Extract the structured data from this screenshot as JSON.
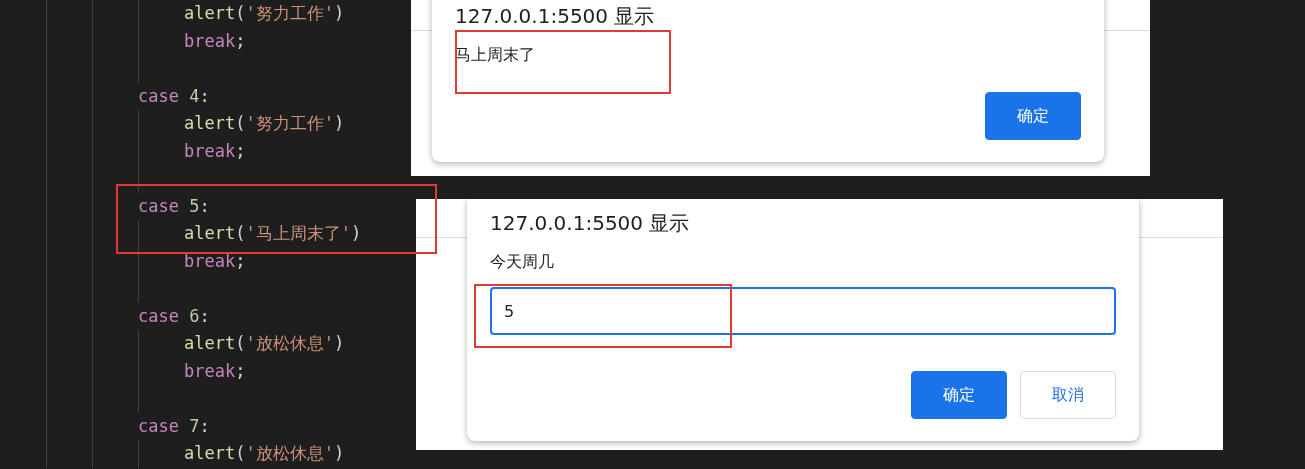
{
  "editor": {
    "lines": [
      {
        "kind": "body",
        "tokens": [
          {
            "kind": "function",
            "text": "alert"
          },
          {
            "kind": "punct",
            "text": "("
          },
          {
            "kind": "string",
            "text": "'努力工作'"
          },
          {
            "kind": "punct",
            "text": ")"
          }
        ]
      },
      {
        "kind": "body",
        "tokens": [
          {
            "kind": "keyword",
            "text": "break"
          },
          {
            "kind": "punct",
            "text": ";"
          }
        ]
      },
      {
        "kind": "blank"
      },
      {
        "kind": "case",
        "tokens": [
          {
            "kind": "keyword",
            "text": "case"
          },
          {
            "kind": "number",
            "text": "4"
          },
          {
            "kind": "punct",
            "text": ":"
          }
        ]
      },
      {
        "kind": "body",
        "tokens": [
          {
            "kind": "function",
            "text": "alert"
          },
          {
            "kind": "punct",
            "text": "("
          },
          {
            "kind": "string",
            "text": "'努力工作'"
          },
          {
            "kind": "punct",
            "text": ")"
          }
        ]
      },
      {
        "kind": "body",
        "tokens": [
          {
            "kind": "keyword",
            "text": "break"
          },
          {
            "kind": "punct",
            "text": ";"
          }
        ]
      },
      {
        "kind": "blank"
      },
      {
        "kind": "case",
        "tokens": [
          {
            "kind": "keyword",
            "text": "case"
          },
          {
            "kind": "number",
            "text": "5"
          },
          {
            "kind": "punct",
            "text": ":"
          }
        ]
      },
      {
        "kind": "body",
        "tokens": [
          {
            "kind": "function",
            "text": "alert"
          },
          {
            "kind": "punct",
            "text": "("
          },
          {
            "kind": "string",
            "text": "'马上周末了'"
          },
          {
            "kind": "punct",
            "text": ")"
          }
        ]
      },
      {
        "kind": "body",
        "tokens": [
          {
            "kind": "keyword",
            "text": "break"
          },
          {
            "kind": "punct",
            "text": ";"
          }
        ]
      },
      {
        "kind": "blank"
      },
      {
        "kind": "case",
        "tokens": [
          {
            "kind": "keyword",
            "text": "case"
          },
          {
            "kind": "number",
            "text": "6"
          },
          {
            "kind": "punct",
            "text": ":"
          }
        ]
      },
      {
        "kind": "body",
        "tokens": [
          {
            "kind": "function",
            "text": "alert"
          },
          {
            "kind": "punct",
            "text": "("
          },
          {
            "kind": "string",
            "text": "'放松休息'"
          },
          {
            "kind": "punct",
            "text": ")"
          }
        ]
      },
      {
        "kind": "body",
        "tokens": [
          {
            "kind": "keyword",
            "text": "break"
          },
          {
            "kind": "punct",
            "text": ";"
          }
        ]
      },
      {
        "kind": "blank"
      },
      {
        "kind": "case",
        "tokens": [
          {
            "kind": "keyword",
            "text": "case"
          },
          {
            "kind": "number",
            "text": "7"
          },
          {
            "kind": "punct",
            "text": ":"
          }
        ]
      },
      {
        "kind": "body",
        "tokens": [
          {
            "kind": "function",
            "text": "alert"
          },
          {
            "kind": "punct",
            "text": "("
          },
          {
            "kind": "string",
            "text": "'放松休息'"
          },
          {
            "kind": "punct",
            "text": ")"
          }
        ]
      }
    ]
  },
  "alert_dialog": {
    "title": "127.0.0.1:5500 显示",
    "message": "马上周末了",
    "buttons": [
      {
        "label": "确定",
        "kind": "primary"
      }
    ]
  },
  "prompt_dialog": {
    "title": "127.0.0.1:5500 显示",
    "message": "今天周几",
    "input": {
      "value": "5"
    },
    "buttons": [
      {
        "label": "确定",
        "kind": "primary"
      },
      {
        "label": "取消",
        "kind": "secondary"
      }
    ]
  }
}
